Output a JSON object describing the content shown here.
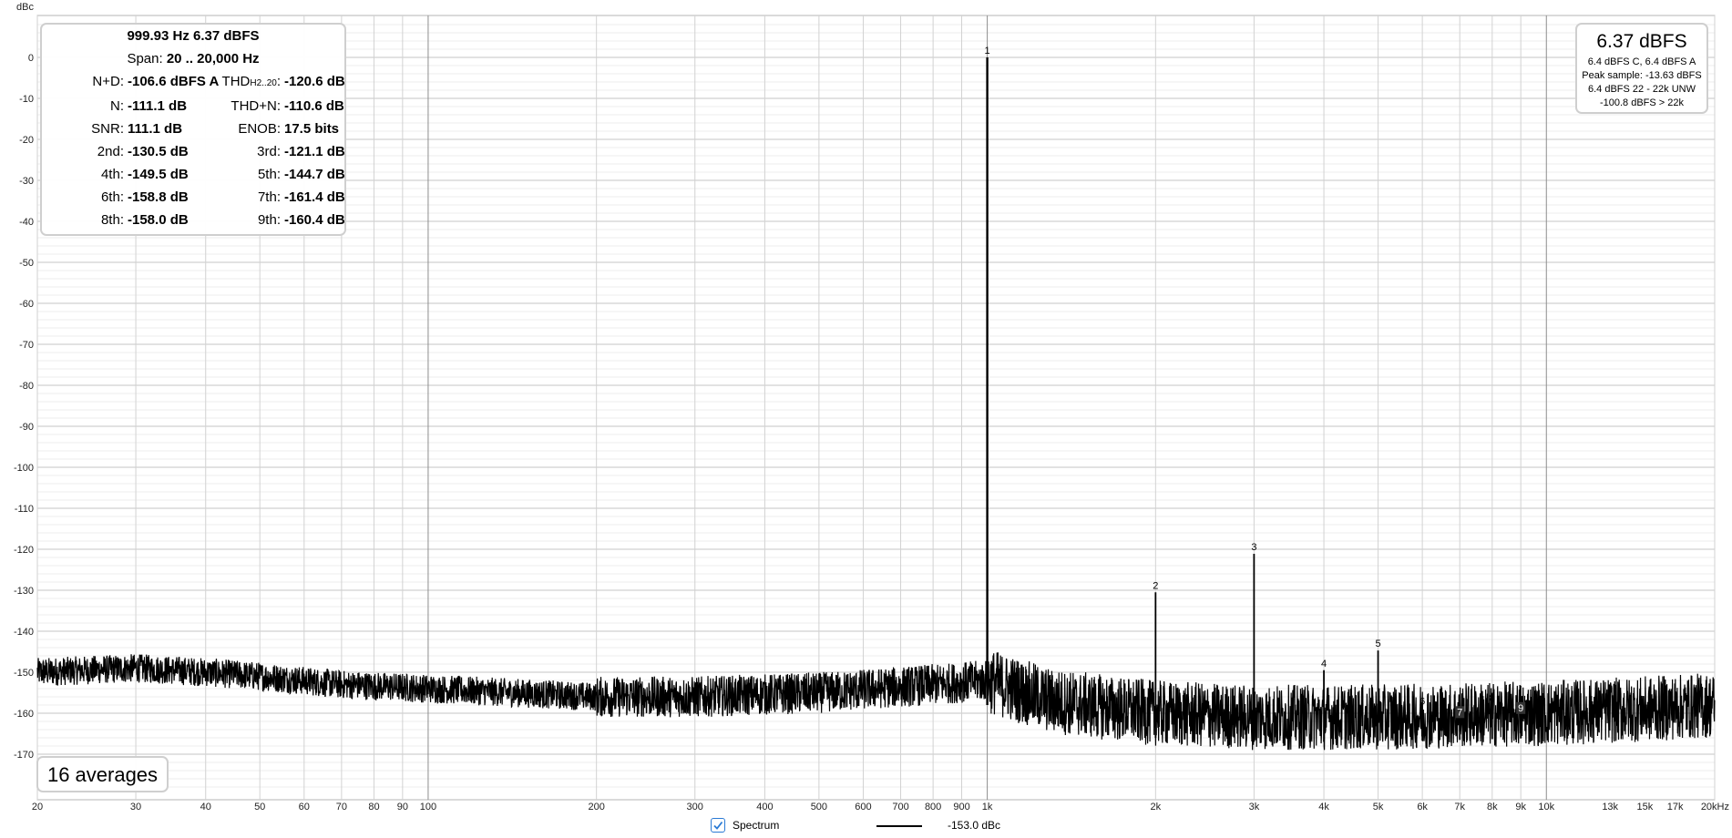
{
  "chart_data": {
    "type": "line",
    "ylabel": "dBc",
    "xunit": "kHz",
    "xscale": "log",
    "xlim": [
      20,
      20000
    ],
    "ylim": [
      -180,
      10
    ],
    "grid": true,
    "yticks": [
      0,
      -10,
      -20,
      -30,
      -40,
      -50,
      -60,
      -70,
      -80,
      -90,
      -100,
      -110,
      -120,
      -130,
      -140,
      -150,
      -160,
      -170
    ],
    "xticks": [
      {
        "v": 20,
        "l": "20"
      },
      {
        "v": 30,
        "l": "30"
      },
      {
        "v": 40,
        "l": "40"
      },
      {
        "v": 50,
        "l": "50"
      },
      {
        "v": 60,
        "l": "60"
      },
      {
        "v": 70,
        "l": "70"
      },
      {
        "v": 80,
        "l": "80"
      },
      {
        "v": 90,
        "l": "90"
      },
      {
        "v": 100,
        "l": "100"
      },
      {
        "v": 200,
        "l": "200"
      },
      {
        "v": 300,
        "l": "300"
      },
      {
        "v": 400,
        "l": "400"
      },
      {
        "v": 500,
        "l": "500"
      },
      {
        "v": 600,
        "l": "600"
      },
      {
        "v": 700,
        "l": "700"
      },
      {
        "v": 800,
        "l": "800"
      },
      {
        "v": 900,
        "l": "900"
      },
      {
        "v": 1000,
        "l": "1k"
      },
      {
        "v": 2000,
        "l": "2k"
      },
      {
        "v": 3000,
        "l": "3k"
      },
      {
        "v": 4000,
        "l": "4k"
      },
      {
        "v": 5000,
        "l": "5k"
      },
      {
        "v": 6000,
        "l": "6k"
      },
      {
        "v": 7000,
        "l": "7k"
      },
      {
        "v": 8000,
        "l": "8k"
      },
      {
        "v": 9000,
        "l": "9k"
      },
      {
        "v": 10000,
        "l": "10k"
      },
      {
        "v": 13000,
        "l": "13k"
      },
      {
        "v": 15000,
        "l": "15k"
      },
      {
        "v": 17000,
        "l": "17k"
      },
      {
        "v": 20000,
        "l": "20kHz"
      }
    ],
    "noise_floor": [
      [
        20,
        -150
      ],
      [
        30,
        -149
      ],
      [
        40,
        -150
      ],
      [
        50,
        -151
      ],
      [
        70,
        -153
      ],
      [
        100,
        -154
      ],
      [
        200,
        -156
      ],
      [
        300,
        -156
      ],
      [
        500,
        -155
      ],
      [
        800,
        -153
      ],
      [
        1000,
        -152
      ],
      [
        1300,
        -157
      ],
      [
        2000,
        -160
      ],
      [
        3000,
        -161
      ],
      [
        5000,
        -161
      ],
      [
        10000,
        -160
      ],
      [
        15000,
        -159
      ],
      [
        20000,
        -158
      ]
    ],
    "peaks": [
      {
        "label": "1",
        "f": 1000,
        "db": 0
      },
      {
        "label": "2",
        "f": 2000,
        "db": -130.5
      },
      {
        "label": "3",
        "f": 3000,
        "db": -121.1
      },
      {
        "label": "4",
        "f": 4000,
        "db": -149.5
      },
      {
        "label": "5",
        "f": 5000,
        "db": -144.7
      },
      {
        "label": "6",
        "f": 6000,
        "db": -158.8
      },
      {
        "label": "7",
        "f": 7000,
        "db": -161.4
      },
      {
        "label": "8",
        "f": 8000,
        "db": -158.0
      },
      {
        "label": "9",
        "f": 9000,
        "db": -160.4
      }
    ],
    "series": [
      {
        "name": "Spectrum",
        "color": "#000000"
      }
    ]
  },
  "stats": {
    "header1": "999.93 Hz  6.37 dBFS",
    "header2_label": "Span:",
    "header2_value": "20 .. 20,000 Hz",
    "rows": [
      [
        {
          "l": "N+D:",
          "v": "-106.6 dBFS A"
        },
        {
          "l": "THD",
          "sub": "H2..20",
          "tail": ":",
          "v": "-120.6 dB"
        }
      ],
      [
        {
          "l": "N:",
          "v": "-111.1 dB"
        },
        {
          "l": "THD+N:",
          "v": "-110.6 dB"
        }
      ],
      [
        {
          "l": "SNR:",
          "v": "111.1 dB"
        },
        {
          "l": "ENOB:",
          "v": "17.5 bits"
        }
      ],
      [
        {
          "l": "2nd:",
          "v": "-130.5 dB"
        },
        {
          "l": "3rd:",
          "v": "-121.1 dB"
        }
      ],
      [
        {
          "l": "4th:",
          "v": "-149.5 dB"
        },
        {
          "l": "5th:",
          "v": "-144.7 dB"
        }
      ],
      [
        {
          "l": "6th:",
          "v": "-158.8 dB"
        },
        {
          "l": "7th:",
          "v": "-161.4 dB"
        }
      ],
      [
        {
          "l": "8th:",
          "v": "-158.0 dB"
        },
        {
          "l": "9th:",
          "v": "-160.4 dB"
        }
      ]
    ]
  },
  "level": {
    "main": "6.37 dBFS",
    "lines": [
      "6.4 dBFS C, 6.4 dBFS A",
      "Peak sample: -13.63 dBFS",
      "6.4 dBFS 22 - 22k UNW",
      "-100.8 dBFS > 22k"
    ]
  },
  "averages": "16 averages",
  "legend": {
    "label": "Spectrum",
    "value": "-153.0 dBc",
    "checked": true
  }
}
